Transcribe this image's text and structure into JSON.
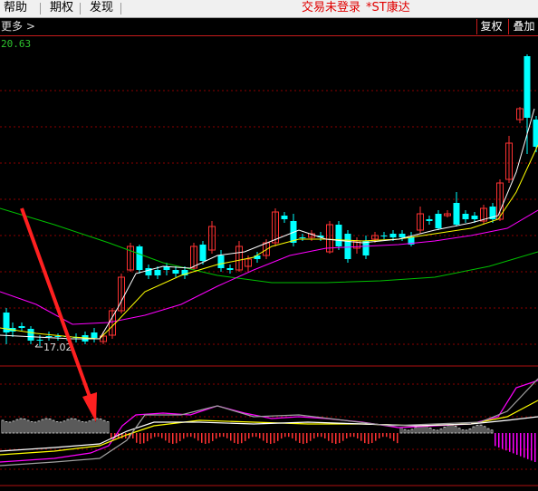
{
  "menubar": {
    "help": "帮助",
    "options": "期权",
    "discover": "发现",
    "trade_status": "交易未登录",
    "stock_name": "*ST康达"
  },
  "toolbar": {
    "more": "更多 >",
    "adjust": "复权",
    "overlay": "叠加"
  },
  "price_axis": {
    "high_label": "20.63",
    "low_label": "17.02"
  },
  "colors": {
    "up": "#ff3232",
    "down": "#00ffff",
    "ma_short": "#ffffff",
    "ma_mid": "#ffff00",
    "ma_long": "#ff00ff",
    "ma_longest": "#00c000",
    "grid": "#8b0000",
    "arrow": "#ff2020"
  },
  "chart_data": {
    "type": "candlestick",
    "price_range": [
      17.02,
      20.63
    ],
    "annotations": [
      "20.63",
      "17.02"
    ]
  }
}
